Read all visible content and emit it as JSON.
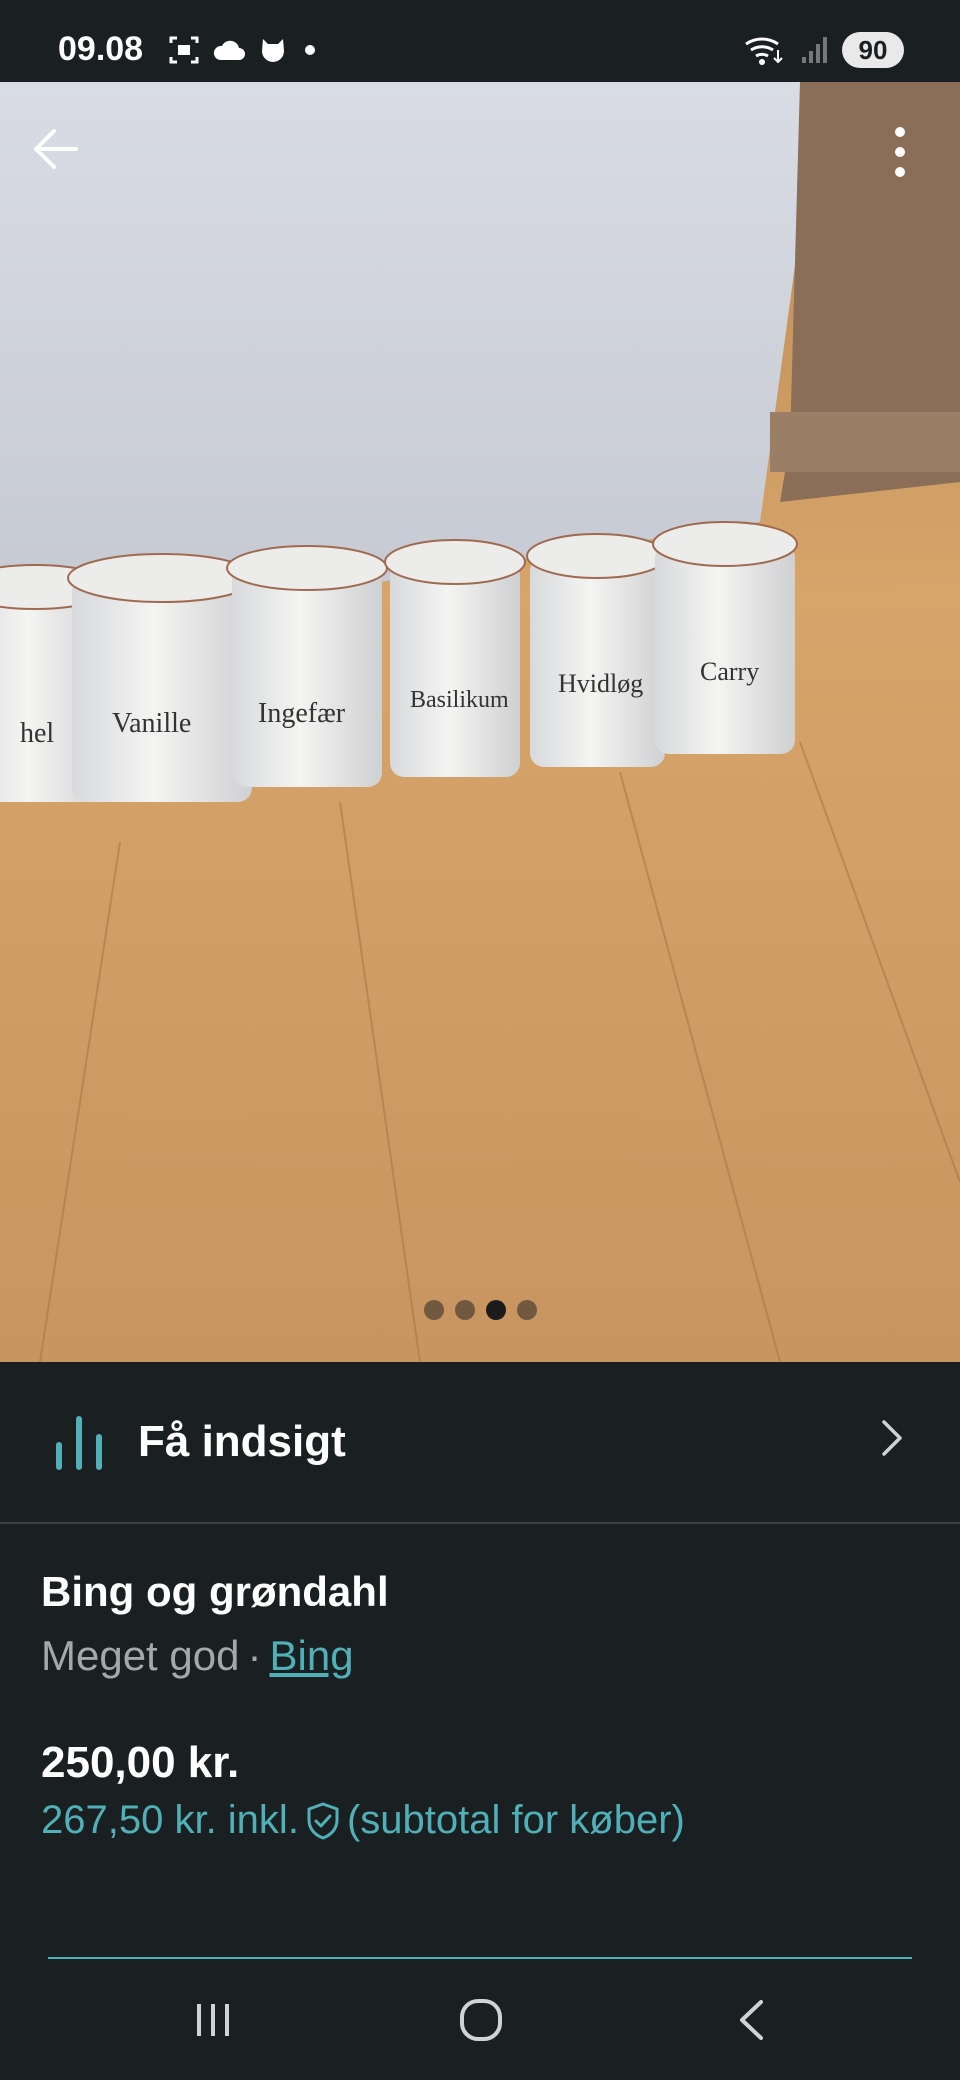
{
  "status_bar": {
    "time": "09.08",
    "battery": "90",
    "icons": [
      "screenshot-icon",
      "cloud-icon",
      "app-notification-icon",
      "dot-icon",
      "wifi-icon",
      "signal-icon"
    ]
  },
  "photo": {
    "jar_labels": [
      "hel",
      "Vanille",
      "Ingefær",
      "Basilikum",
      "Hvidløg",
      "Carry"
    ],
    "page_count": 4,
    "active_page": 3
  },
  "insight": {
    "label": "Få indsigt"
  },
  "item": {
    "title": "Bing og grøndahl",
    "condition": "Meget god",
    "separator": "·",
    "brand": "Bing",
    "price": "250,00 kr.",
    "price_incl": "267,50 kr. inkl.",
    "price_incl_suffix": "(subtotal for køber)"
  },
  "colors": {
    "accent": "#4fb0b8",
    "background": "#1a1f21",
    "muted_text": "#a3a8aa"
  }
}
